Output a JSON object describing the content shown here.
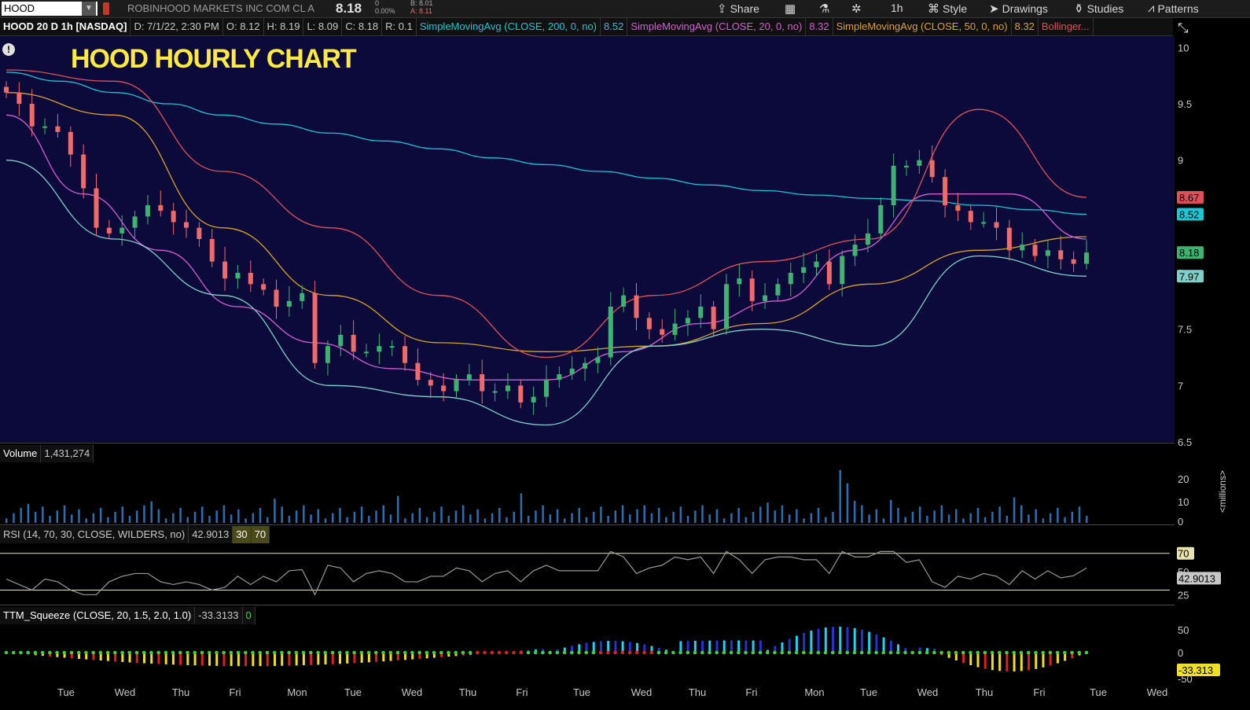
{
  "toolbar": {
    "symbol": "HOOD",
    "company": "ROBINHOOD MARKETS INC COM CL A",
    "last": "8.18",
    "change_top": "0",
    "change_pct": "0.00%",
    "bid": "B: 8.01",
    "ask": "A: 8.11",
    "share": "Share",
    "interval": "1h",
    "style": "Style",
    "drawings": "Drawings",
    "studies": "Studies",
    "patterns": "Patterns"
  },
  "header": {
    "title": "HOOD 20 D 1h [NASDAQ]",
    "date": "D: 7/1/22, 2:30 PM",
    "open": "O: 8.12",
    "high": "H: 8.19",
    "low": "L: 8.09",
    "close": "C: 8.18",
    "range": "R: 0.1",
    "sma200_label": "SimpleMovingAvg (CLOSE, 200, 0, no)",
    "sma200_val": "8.52",
    "sma20_label": "SimpleMovingAvg (CLOSE, 20, 0, no)",
    "sma20_val": "8.32",
    "sma50_label": "SimpleMovingAvg (CLOSE, 50, 0, no)",
    "sma50_val": "8.32",
    "boll_label": "Bollinger..."
  },
  "overlay_title": "HOOD HOURLY CHART",
  "colors": {
    "bg": "#0b0a3a",
    "up": "#3cb371",
    "down": "#f06a6a",
    "sma200": "#19c7d6",
    "sma20": "#d45fd4",
    "sma50": "#d9a326",
    "boll_upper": "#e0505a",
    "boll_lower": "#7fd0c8"
  },
  "volume": {
    "label": "Volume",
    "value": "1,431,274",
    "unit": "<millions>"
  },
  "rsi": {
    "label": "RSI (14, 70, 30, CLOSE, WILDERS, no)",
    "value": "42.9013",
    "os": "30",
    "ob": "70"
  },
  "ttm": {
    "label": "TTM_Squeeze (CLOSE, 20, 1.5, 2.0, 1.0)",
    "value": "-33.3133",
    "sq": "0"
  },
  "x_labels": [
    "Tue",
    "Wed",
    "Thu",
    "Fri",
    "Mon",
    "Tue",
    "Wed",
    "Thu",
    "Fri",
    "Tue",
    "Wed",
    "Thu",
    "Fri",
    "Mon",
    "Tue",
    "Wed",
    "Thu",
    "Fri",
    "Tue",
    "Wed"
  ],
  "price_axis": [
    "10",
    "9.5",
    "9",
    "8.5",
    "8",
    "7.5",
    "7",
    "6.5"
  ],
  "price_tags": [
    {
      "text": "8.67",
      "color": "#e0505a",
      "val": 8.67
    },
    {
      "text": "8.52",
      "color": "#19c7d6",
      "val": 8.52
    },
    {
      "text": "8.18",
      "color": "#3cb371",
      "val": 8.18
    },
    {
      "text": "7.97",
      "color": "#7fd0c8",
      "val": 7.97
    }
  ],
  "vol_axis": [
    "20",
    "10",
    "0"
  ],
  "rsi_axis": [
    "70",
    "50",
    "25"
  ],
  "rsi_value_tag": "42.9013",
  "ttm_axis": [
    "50",
    "0",
    "-50"
  ],
  "ttm_value_tag": "-33.313",
  "chart_data": {
    "type": "line",
    "title": "HOOD HOURLY CHART",
    "ylim": [
      6.5,
      10.1
    ],
    "close": [
      9.6,
      9.5,
      9.3,
      9.3,
      9.25,
      9.05,
      8.75,
      8.4,
      8.35,
      8.4,
      8.5,
      8.6,
      8.55,
      8.45,
      8.4,
      8.3,
      8.1,
      7.95,
      8.0,
      7.9,
      7.85,
      7.7,
      7.75,
      7.82,
      7.2,
      7.35,
      7.45,
      7.3,
      7.3,
      7.35,
      7.35,
      7.2,
      7.05,
      7.0,
      6.95,
      7.05,
      7.1,
      6.95,
      6.95,
      7.0,
      6.85,
      6.9,
      7.05,
      7.1,
      7.15,
      7.2,
      7.25,
      7.7,
      7.8,
      7.6,
      7.5,
      7.45,
      7.55,
      7.6,
      7.7,
      7.5,
      7.9,
      7.95,
      7.75,
      7.8,
      7.9,
      8.0,
      8.05,
      8.1,
      7.9,
      8.15,
      8.25,
      8.35,
      8.6,
      8.95,
      8.95,
      9.0,
      8.85,
      8.6,
      8.55,
      8.45,
      8.45,
      8.4,
      8.2,
      8.25,
      8.15,
      8.2,
      8.12,
      8.08,
      8.18
    ],
    "sma200": [
      9.78,
      9.7,
      9.6,
      9.5,
      9.4,
      9.32,
      9.24,
      9.17,
      9.1,
      9.02,
      8.96,
      8.9,
      8.84,
      8.78,
      8.73,
      8.69,
      8.66,
      8.64,
      8.6,
      8.56,
      8.52
    ],
    "sma20": [
      9.4,
      8.7,
      8.2,
      7.7,
      7.38,
      7.15,
      7.05,
      7.05,
      7.3,
      7.55,
      7.75,
      8.2,
      8.7,
      8.7,
      8.3
    ],
    "sma50": [
      9.6,
      9.4,
      8.4,
      7.8,
      7.38,
      7.3,
      7.35,
      7.55,
      7.9,
      8.2,
      8.32
    ],
    "boll_upper": [
      9.8,
      9.7,
      8.9,
      8.4,
      7.8,
      7.25,
      7.8,
      8.1,
      8.3,
      9.45,
      8.67
    ],
    "boll_lower": [
      9.0,
      8.3,
      7.8,
      7.0,
      6.9,
      6.65,
      7.35,
      7.5,
      7.35,
      8.15,
      7.97
    ],
    "rsi_last": 42.9013,
    "ttm_last": -33.3133
  }
}
